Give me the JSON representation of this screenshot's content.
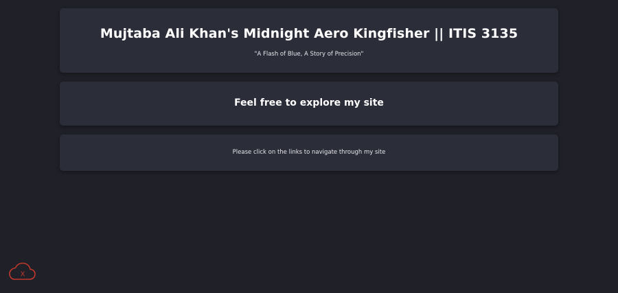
{
  "header": {
    "title": "Mujtaba Ali Khan's Midnight Aero Kingfisher || ITIS 3135",
    "tagline": "\"A Flash of Blue, A Story of Precision\""
  },
  "welcome": {
    "heading": "Feel free to explore my site"
  },
  "info": {
    "text": "Please click on the links to navigate through my site"
  },
  "widget": {
    "icon": "cloud-x-icon",
    "label": "X",
    "color": "#c0392b"
  }
}
